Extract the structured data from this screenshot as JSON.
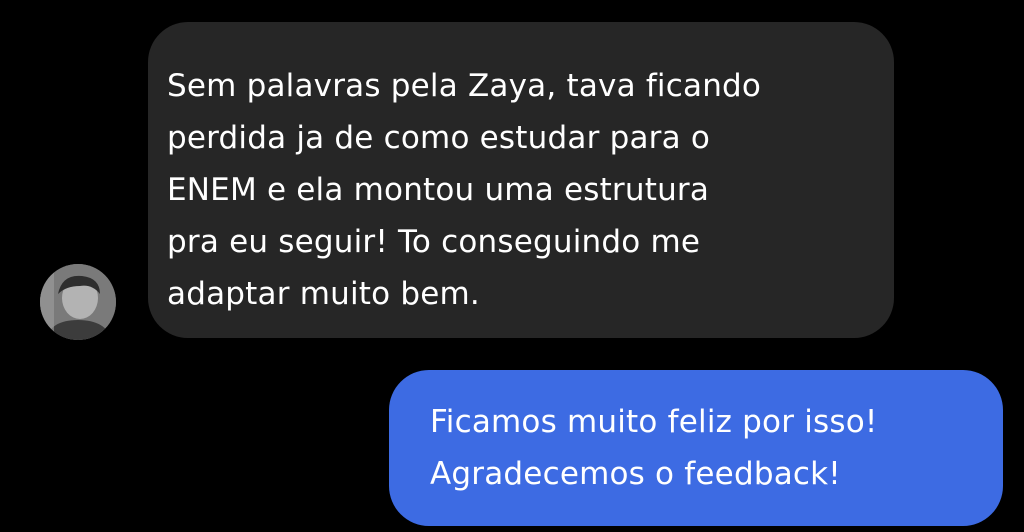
{
  "conversation": {
    "received": {
      "lines": [
        "Sem palavras pela Zaya, tava ficando",
        "perdida ja de como estudar para o",
        "ENEM e ela montou uma estrutura",
        "pra eu seguir! To conseguindo me",
        "adaptar muito bem."
      ]
    },
    "sent": {
      "lines": [
        "Ficamos muito feliz por isso!",
        "Agradecemos o feedback!"
      ]
    }
  },
  "colors": {
    "background": "#000000",
    "received_bubble": "#262626",
    "sent_bubble": "#3d6be3",
    "text": "#ffffff"
  },
  "icons": {
    "avatar": "user-avatar-photo"
  }
}
